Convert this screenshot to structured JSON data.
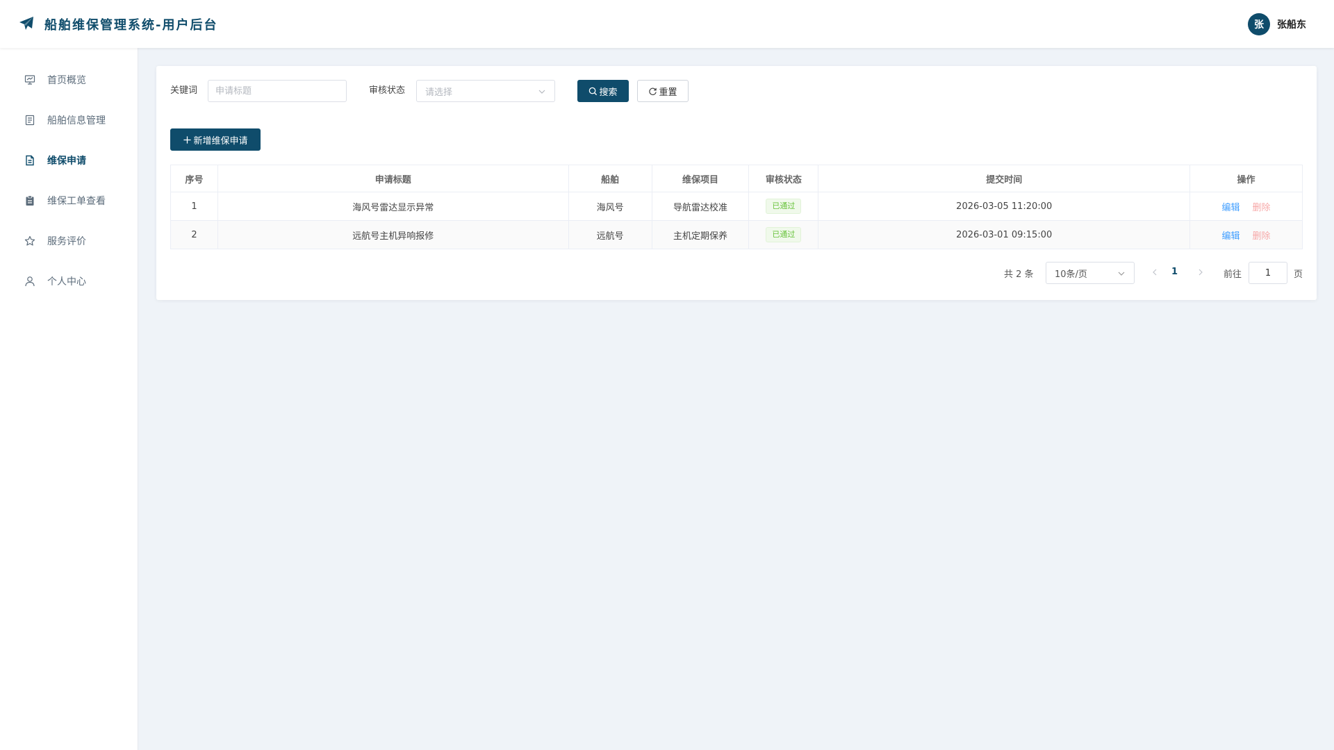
{
  "header": {
    "title": "船舶维保管理系统-用户后台",
    "logo_icon": "paper-plane-icon",
    "user": {
      "avatar_text": "张",
      "name": "张船东"
    }
  },
  "sidebar": {
    "items": [
      {
        "label": "首页概览",
        "icon": "presentation-board-icon",
        "active": false
      },
      {
        "label": "船舶信息管理",
        "icon": "document-icon",
        "active": false
      },
      {
        "label": "维保申请",
        "icon": "document-lines-icon",
        "active": true
      },
      {
        "label": "维保工单查看",
        "icon": "clipboard-icon",
        "active": false
      },
      {
        "label": "服务评价",
        "icon": "star-icon",
        "active": false
      },
      {
        "label": "个人中心",
        "icon": "user-icon",
        "active": false
      }
    ]
  },
  "filters": {
    "keyword_label": "关键词",
    "keyword_placeholder": "申请标题",
    "keyword_value": "",
    "status_label": "审核状态",
    "status_placeholder": "请选择",
    "search_label": "搜索",
    "reset_label": "重置"
  },
  "actions": {
    "add_label": "新增维保申请"
  },
  "table": {
    "columns": [
      "序号",
      "申请标题",
      "船舶",
      "维保项目",
      "审核状态",
      "提交时间",
      "操作"
    ],
    "rows": [
      {
        "index": "1",
        "title": "海风号雷达显示异常",
        "ship": "海风号",
        "project": "导航雷达校准",
        "status": "已通过",
        "time": "2026-03-05 11:20:00",
        "edit": "编辑",
        "delete": "删除"
      },
      {
        "index": "2",
        "title": "远航号主机异响报修",
        "ship": "远航号",
        "project": "主机定期保养",
        "status": "已通过",
        "time": "2026-03-01 09:15:00",
        "edit": "编辑",
        "delete": "删除"
      }
    ]
  },
  "pagination": {
    "total_text": "共 2 条",
    "page_size": "10条/页",
    "current_page": "1",
    "goto_label": "前往",
    "goto_value": "1",
    "page_suffix": "页"
  },
  "colors": {
    "brand": "#0f4c6b",
    "success_tag": "#67c23a",
    "link": "#409eff",
    "danger_link": "#f7a8a8"
  }
}
